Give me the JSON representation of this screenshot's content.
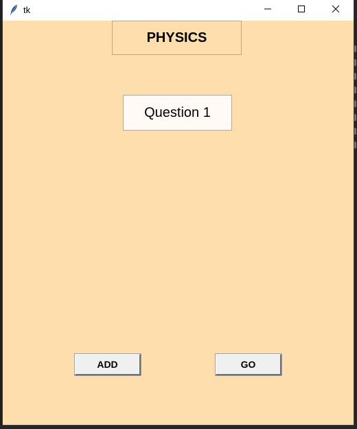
{
  "window": {
    "title": "tk",
    "background_color": "#ffdead"
  },
  "titlebar": {
    "icon": "feather-icon",
    "minimize_icon": "minimize-icon",
    "maximize_icon": "maximize-icon",
    "close_icon": "close-icon"
  },
  "main": {
    "subject_label": "PHYSICS",
    "question_button": "Question 1",
    "add_button": "ADD",
    "go_button": "GO"
  }
}
